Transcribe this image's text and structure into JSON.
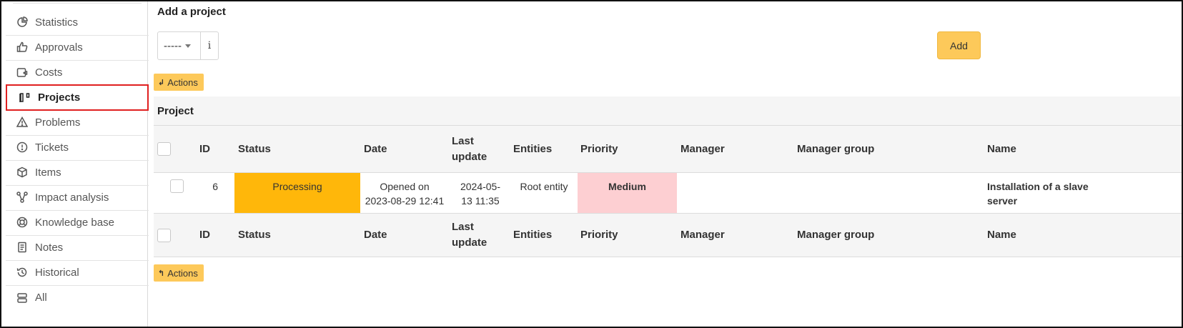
{
  "sidebar": {
    "items": [
      {
        "label": "Statistics",
        "icon": "chart-pie-icon"
      },
      {
        "label": "Approvals",
        "icon": "thumbs-up-icon"
      },
      {
        "label": "Costs",
        "icon": "wallet-icon"
      },
      {
        "label": "Projects",
        "icon": "kanban-icon",
        "active": true
      },
      {
        "label": "Problems",
        "icon": "warning-triangle-icon"
      },
      {
        "label": "Tickets",
        "icon": "alert-circle-icon"
      },
      {
        "label": "Items",
        "icon": "package-icon"
      },
      {
        "label": "Impact analysis",
        "icon": "network-icon"
      },
      {
        "label": "Knowledge base",
        "icon": "lifebuoy-icon"
      },
      {
        "label": "Notes",
        "icon": "notes-icon"
      },
      {
        "label": "Historical",
        "icon": "history-icon"
      },
      {
        "label": "All",
        "icon": "stack-icon"
      }
    ]
  },
  "add_project": {
    "title": "Add a project",
    "select_value": "-----",
    "info_label": "i",
    "add_label": "Add"
  },
  "actions_label": "Actions",
  "table": {
    "title": "Project",
    "columns": [
      "ID",
      "Status",
      "Date",
      "Last update",
      "Entities",
      "Priority",
      "Manager",
      "Manager group",
      "Name"
    ],
    "col_id": "ID",
    "col_status": "Status",
    "col_date": "Date",
    "col_last_update_1": "Last",
    "col_last_update_2": "update",
    "col_entities": "Entities",
    "col_priority": "Priority",
    "col_manager": "Manager",
    "col_manager_group": "Manager group",
    "col_name": "Name",
    "rows": [
      {
        "id": "6",
        "status": "Processing",
        "date_1": "Opened on",
        "date_2": "2023-08-29 12:41",
        "last_update_1": "2024-05-",
        "last_update_2": "13 11:35",
        "entities": "Root entity",
        "priority": "Medium",
        "manager": "",
        "manager_group": "",
        "name_1": "Installation of a slave",
        "name_2": "server"
      }
    ]
  },
  "colors": {
    "accent": "#fdc95a",
    "status_processing": "#ffb70a",
    "priority_medium": "#fdcfd2",
    "link": "#3a5795",
    "active_outline": "#e02020"
  }
}
